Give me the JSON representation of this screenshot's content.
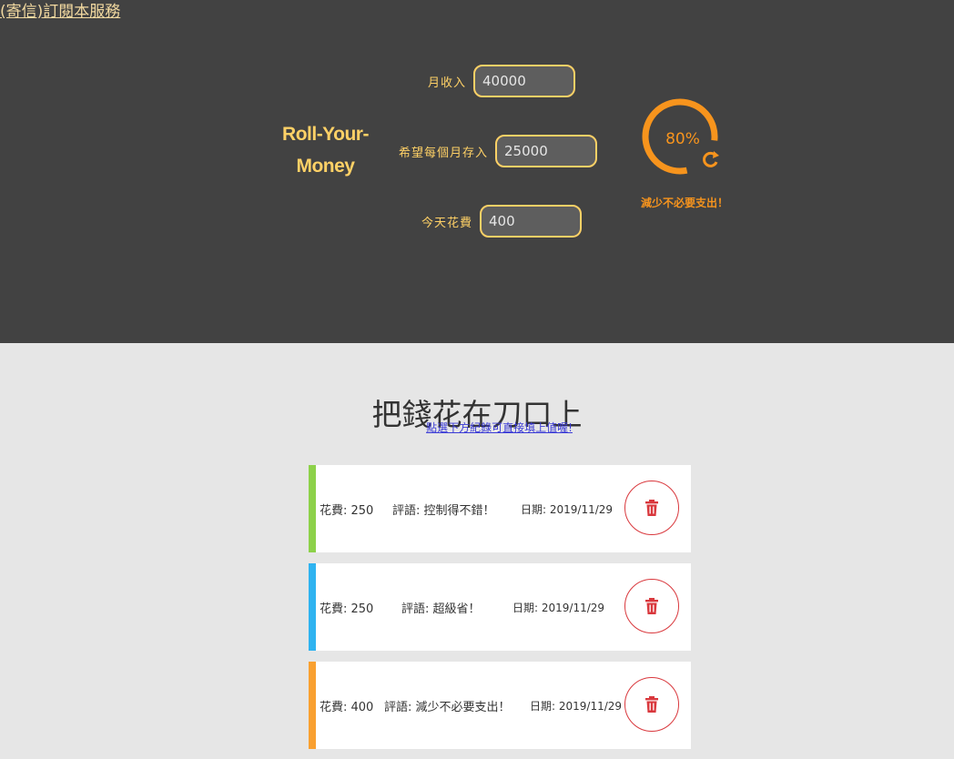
{
  "header": {
    "subscribe_link": "(寄信)訂閱本服務",
    "brand_line1": "Roll-Your-",
    "brand_line2": "Money",
    "income": {
      "label": "月收入",
      "value": "40000"
    },
    "saving": {
      "label": "希望每個月存入",
      "value": "25000"
    },
    "today": {
      "label": "今天花費",
      "value": "400"
    },
    "progress": {
      "percent_text": "80%",
      "fraction": 0.8,
      "message": "減少不必要支出！"
    }
  },
  "main": {
    "title": "把錢花在刀口上",
    "hint_link": "點選下方紀錄可直接填上值喔!",
    "records": [
      {
        "amount": "花費: 250",
        "comment": "評語: 控制得不錯！",
        "date": "日期: 2019/11/29",
        "color": "#8dd14a"
      },
      {
        "amount": "花費: 250",
        "comment": "評語: 超級省！",
        "date": "日期: 2019/11/29",
        "color": "#2fb3f0"
      },
      {
        "amount": "花費: 400",
        "comment": "評語: 減少不必要支出！",
        "date": "日期: 2019/11/29",
        "color": "#f9a030"
      }
    ]
  },
  "colors": {
    "accent": "#ffd166",
    "progress": "#f7941d",
    "delete": "#d9383d"
  },
  "icons": {
    "delete": "trash-icon",
    "refresh": "refresh-icon"
  }
}
